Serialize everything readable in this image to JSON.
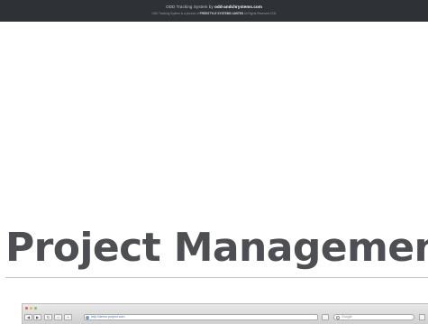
{
  "footer_banner": {
    "line1_prefix": "ODD Tracking System by",
    "line1_link": "odd-andchrystems.com",
    "line2_text": "ODD Tracking System is a product of",
    "line2_strong": "FREESTYLE SYSTEMS LIMITED",
    "line2_suffix": "All Rights Reserved 2011"
  },
  "section": {
    "heading": "Project Management"
  },
  "browser_screenshot": {
    "url": "http://demo.project.com",
    "search_placeholder": "Google"
  },
  "colors": {
    "banner_bg": "#2e3135",
    "heading_text": "#4e4f52",
    "page_bg": "#ffffff"
  }
}
